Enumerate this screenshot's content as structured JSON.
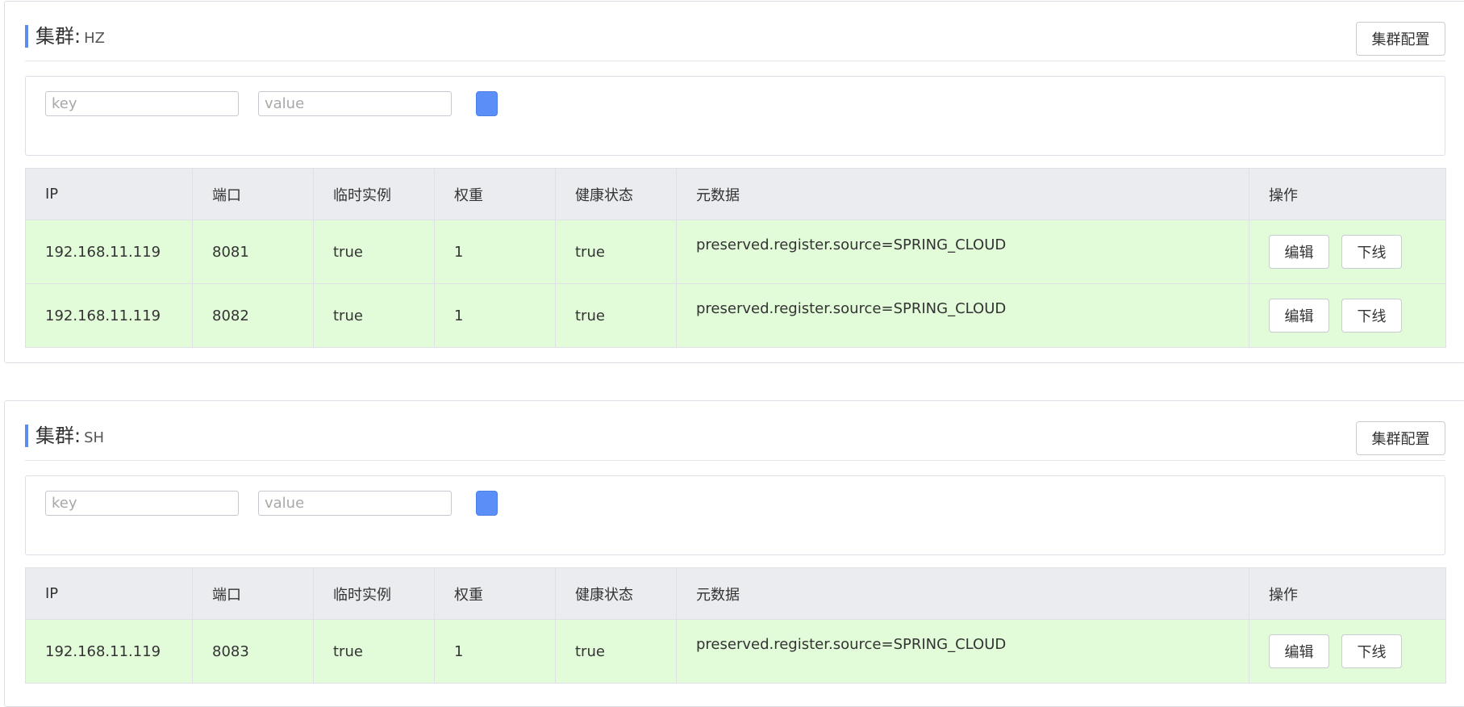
{
  "clusters": [
    {
      "label": "集群:",
      "name": "HZ",
      "config_button": "集群配置",
      "filter": {
        "key_placeholder": "key",
        "value_placeholder": "value"
      },
      "columns": [
        "IP",
        "端口",
        "临时实例",
        "权重",
        "健康状态",
        "元数据",
        "操作"
      ],
      "rows": [
        {
          "ip": "192.168.11.119",
          "port": "8081",
          "ephemeral": "true",
          "weight": "1",
          "healthy": "true",
          "metadata": "preserved.register.source=SPRING_CLOUD",
          "edit_label": "编辑",
          "offline_label": "下线"
        },
        {
          "ip": "192.168.11.119",
          "port": "8082",
          "ephemeral": "true",
          "weight": "1",
          "healthy": "true",
          "metadata": "preserved.register.source=SPRING_CLOUD",
          "edit_label": "编辑",
          "offline_label": "下线"
        }
      ]
    },
    {
      "label": "集群:",
      "name": "SH",
      "config_button": "集群配置",
      "filter": {
        "key_placeholder": "key",
        "value_placeholder": "value"
      },
      "columns": [
        "IP",
        "端口",
        "临时实例",
        "权重",
        "健康状态",
        "元数据",
        "操作"
      ],
      "rows": [
        {
          "ip": "192.168.11.119",
          "port": "8083",
          "ephemeral": "true",
          "weight": "1",
          "healthy": "true",
          "metadata": "preserved.register.source=SPRING_CLOUD",
          "edit_label": "编辑",
          "offline_label": "下线"
        }
      ]
    }
  ],
  "colors": {
    "accent": "#5a8dee",
    "row_background": "#e2fbd9",
    "header_background": "#ebecef"
  }
}
